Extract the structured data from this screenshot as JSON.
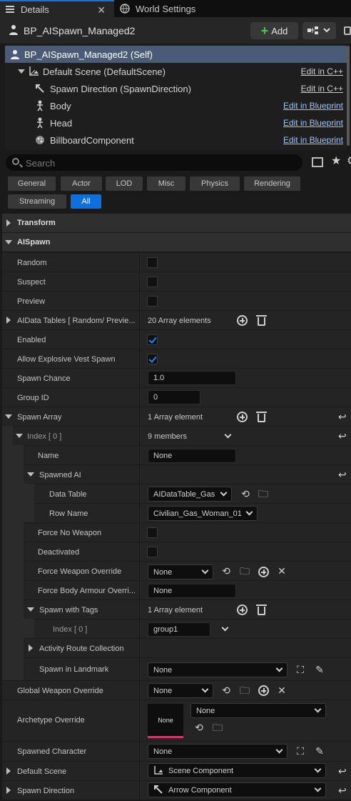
{
  "tabs": [
    {
      "label": "Details",
      "active": true
    },
    {
      "label": "World Settings",
      "active": false
    }
  ],
  "header": {
    "title": "BP_AISpawn_Managed2",
    "add_label": "Add"
  },
  "component_tree": [
    {
      "label": "BP_AISpawn_Managed2 (Self)",
      "edit": ""
    },
    {
      "label": "Default Scene (DefaultScene)",
      "edit": "Edit in C++"
    },
    {
      "label": "Spawn Direction (SpawnDirection)",
      "edit": "Edit in C++"
    },
    {
      "label": "Body",
      "edit": "Edit in Blueprint"
    },
    {
      "label": "Head",
      "edit": "Edit in Blueprint"
    },
    {
      "label": "BillboardComponent",
      "edit": "Edit in Blueprint"
    }
  ],
  "search": {
    "placeholder": "Search"
  },
  "filters": [
    "General",
    "Actor",
    "LOD",
    "Misc",
    "Physics",
    "Rendering",
    "Streaming",
    "All"
  ],
  "active_filter": "All",
  "categories": {
    "transform": "Transform",
    "aispawn": "AISpawn"
  },
  "props": {
    "random": {
      "name": "Random",
      "checked": false
    },
    "suspect": {
      "name": "Suspect",
      "checked": false
    },
    "preview": {
      "name": "Preview",
      "checked": false
    },
    "aidata_tables": {
      "name": "AIData Tables [ Random/ Previe...",
      "value": "20 Array elements"
    },
    "enabled": {
      "name": "Enabled",
      "checked": true
    },
    "allow_vest": {
      "name": "Allow Explosive Vest Spawn",
      "checked": true
    },
    "spawn_chance": {
      "name": "Spawn Chance",
      "value": "1.0"
    },
    "group_id": {
      "name": "Group ID",
      "value": "0"
    },
    "spawn_array": {
      "name": "Spawn Array",
      "value": "1 Array element"
    },
    "index0": {
      "name": "Index [ 0 ]",
      "value": "9 members"
    },
    "name": {
      "name": "Name",
      "value": "None"
    },
    "spawned_ai": {
      "name": "Spawned AI"
    },
    "data_table": {
      "name": "Data Table",
      "value": "AIDataTable_Gas"
    },
    "row_name": {
      "name": "Row Name",
      "value": "Civilian_Gas_Woman_01"
    },
    "force_no_weapon": {
      "name": "Force No Weapon",
      "checked": false
    },
    "deactivated": {
      "name": "Deactivated",
      "checked": false
    },
    "force_weapon_override": {
      "name": "Force Weapon Override",
      "value": "None"
    },
    "force_body_armour": {
      "name": "Force Body Armour Overri...",
      "value": "None"
    },
    "spawn_with_tags": {
      "name": "Spawn with Tags",
      "value": "1 Array element"
    },
    "tag_index0": {
      "name": "Index [ 0 ]",
      "value": "group1"
    },
    "activity_route": {
      "name": "Activity Route Collection"
    },
    "spawn_in_landmark": {
      "name": "Spawn in Landmark",
      "value": "None"
    },
    "global_weapon_override": {
      "name": "Global Weapon Override",
      "value": "None"
    },
    "archetype_override": {
      "name": "Archetype Override",
      "value": "None",
      "thumb": "None"
    },
    "spawned_character": {
      "name": "Spawned Character",
      "value": "None"
    },
    "default_scene": {
      "name": "Default Scene",
      "value": "Scene Component"
    },
    "spawn_direction": {
      "name": "Spawn Direction",
      "value": "Arrow Component"
    }
  },
  "colors": {
    "accent": "#0f6fdd",
    "selection": "#4a5b78",
    "link": "#9ac5ff",
    "check": "#1f86ff"
  }
}
